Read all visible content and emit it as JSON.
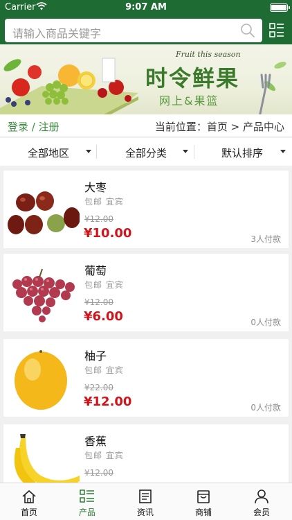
{
  "status_bar": {
    "carrier": "Carrier",
    "time": "9:07 AM"
  },
  "search": {
    "placeholder": "请输入商品关键字"
  },
  "banner": {
    "english": "Fruit this season",
    "title": "时令鲜果",
    "subtitle": "网上&果篮"
  },
  "crumb": {
    "login": "登录 / 注册",
    "location": "当前位置：首页 > 产品中心"
  },
  "filters": [
    "全部地区",
    "全部分类",
    "默认排序"
  ],
  "products": [
    {
      "name": "大枣",
      "tags": "包邮 宜宾",
      "old_price": "¥12.00",
      "price": "¥10.00",
      "sold": "3人付款",
      "image": "jujube-image"
    },
    {
      "name": "葡萄",
      "tags": "包邮 宜宾",
      "old_price": "¥12.00",
      "price": "¥6.00",
      "sold": "0人付款",
      "image": "grapes-image"
    },
    {
      "name": "柚子",
      "tags": "包邮 宜宾",
      "old_price": "¥22.00",
      "price": "¥12.00",
      "sold": "0人付款",
      "image": "pomelo-image"
    },
    {
      "name": "香蕉",
      "tags": "包邮 宜宾",
      "old_price": "¥12.00",
      "price": "",
      "sold": "",
      "image": "banana-image"
    }
  ],
  "tabs": [
    {
      "label": "首页",
      "icon": "home-icon",
      "active": false
    },
    {
      "label": "产品",
      "icon": "product-list-icon",
      "active": true
    },
    {
      "label": "资讯",
      "icon": "news-icon",
      "active": false
    },
    {
      "label": "商铺",
      "icon": "shop-icon",
      "active": false
    },
    {
      "label": "会员",
      "icon": "member-icon",
      "active": false
    }
  ],
  "colors": {
    "header": "#1f6b34",
    "accent_green": "#2e7d32",
    "price_red": "#d0141b"
  }
}
